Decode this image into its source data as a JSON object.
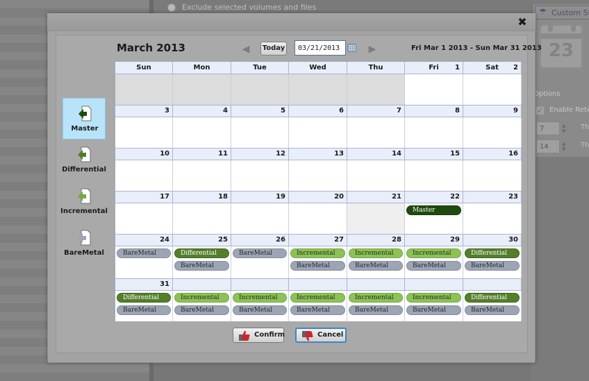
{
  "background": {
    "exclude_option": "Exclude selected volumes and files",
    "custom_strategy_label": "Custom Stra",
    "calendar_icon_day": "23",
    "options_label": "Options",
    "enable_retention_label": "Enable Reter",
    "retention_value_1": "7",
    "retention_value_2": "14",
    "retention_suffix_1": "The",
    "retention_suffix_2": "The"
  },
  "dialog": {
    "close_label": "✖",
    "month_title": "March 2013",
    "prev_label": "◀",
    "next_label": "▶",
    "today_button": "Today",
    "date_value": "03/21/2013",
    "range_label": "Fri Mar 1 2013 - Sun Mar 31 2013",
    "confirm_button": "Confirm",
    "cancel_button": "Cancel"
  },
  "sidebar": {
    "items": [
      {
        "label": "Master",
        "color": "#1f4a0e",
        "selected": true
      },
      {
        "label": "Differential",
        "color": "#537f2b",
        "selected": false
      },
      {
        "label": "Incremental",
        "color": "#74a945",
        "selected": false
      },
      {
        "label": "BareMetal",
        "color": "#9da4b3",
        "selected": false
      }
    ]
  },
  "calendar": {
    "days_of_week": [
      "Sun",
      "Mon",
      "Tue",
      "Wed",
      "Thu",
      "Fri",
      "Sat"
    ],
    "weeks": [
      [
        {
          "day": ""
        },
        {
          "day": ""
        },
        {
          "day": ""
        },
        {
          "day": ""
        },
        {
          "day": ""
        },
        {
          "day": "1"
        },
        {
          "day": "2"
        }
      ],
      [
        {
          "day": "3"
        },
        {
          "day": "4"
        },
        {
          "day": "5"
        },
        {
          "day": "6"
        },
        {
          "day": "7"
        },
        {
          "day": "8"
        },
        {
          "day": "9"
        }
      ],
      [
        {
          "day": "10"
        },
        {
          "day": "11"
        },
        {
          "day": "12"
        },
        {
          "day": "13"
        },
        {
          "day": "14"
        },
        {
          "day": "15"
        },
        {
          "day": "16"
        }
      ],
      [
        {
          "day": "17"
        },
        {
          "day": "18"
        },
        {
          "day": "19"
        },
        {
          "day": "20"
        },
        {
          "day": "21",
          "today": true
        },
        {
          "day": "22",
          "events": [
            "Master"
          ]
        },
        {
          "day": "23"
        }
      ],
      [
        {
          "day": "24",
          "events": [
            "BareMetal"
          ]
        },
        {
          "day": "25",
          "events": [
            "Differential",
            "BareMetal"
          ]
        },
        {
          "day": "26",
          "events": [
            "BareMetal"
          ]
        },
        {
          "day": "27",
          "events": [
            "Incremental",
            "BareMetal"
          ]
        },
        {
          "day": "28",
          "events": [
            "Incremental",
            "BareMetal"
          ]
        },
        {
          "day": "29",
          "events": [
            "Incremental",
            "BareMetal"
          ]
        },
        {
          "day": "30",
          "events": [
            "Differential",
            "BareMetal"
          ]
        }
      ],
      [
        {
          "day": "31",
          "events": [
            "Differential",
            "BareMetal"
          ]
        },
        {
          "day": "",
          "events": [
            "Incremental",
            "BareMetal"
          ]
        },
        {
          "day": "",
          "events": [
            "Incremental",
            "BareMetal"
          ]
        },
        {
          "day": "",
          "events": [
            "Incremental",
            "BareMetal"
          ]
        },
        {
          "day": "",
          "events": [
            "Incremental",
            "BareMetal"
          ]
        },
        {
          "day": "",
          "events": [
            "Incremental",
            "BareMetal"
          ]
        },
        {
          "day": "",
          "events": [
            "Differential",
            "BareMetal"
          ]
        }
      ]
    ]
  }
}
